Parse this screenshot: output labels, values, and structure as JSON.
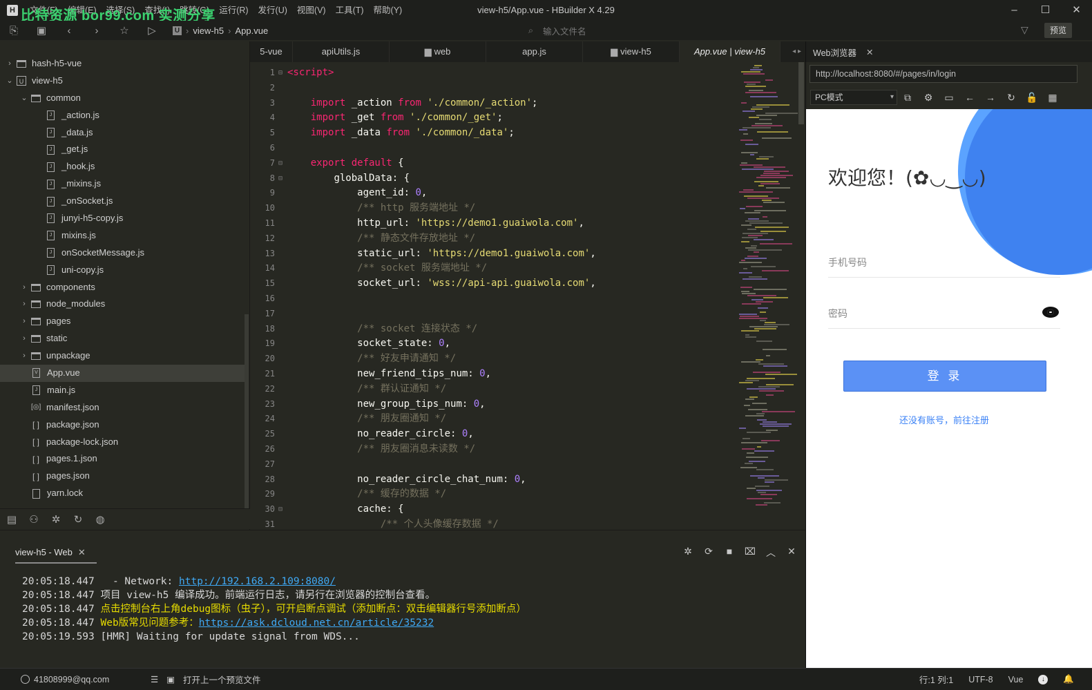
{
  "window": {
    "title": "view-h5/App.vue - HBuilder X 4.29",
    "watermark": "比特资源 bor99.com 实测分享",
    "menus": [
      "文件(F)",
      "编辑(E)",
      "选择(S)",
      "查找(I)",
      "跳转(G)",
      "运行(R)",
      "发行(U)",
      "视图(V)",
      "工具(T)",
      "帮助(Y)"
    ]
  },
  "toolbar": {
    "breadcrumb": [
      "view-h5",
      "App.vue"
    ],
    "file_search_placeholder": "输入文件名",
    "preview_label": "预览"
  },
  "sidebar": {
    "tree": [
      {
        "label": "hash-h5-vue",
        "type": "folder",
        "depth": 0,
        "expanded": false
      },
      {
        "label": "view-h5",
        "type": "project",
        "depth": 0,
        "expanded": true
      },
      {
        "label": "common",
        "type": "folder",
        "depth": 1,
        "expanded": true
      },
      {
        "label": "_action.js",
        "type": "file",
        "depth": 2
      },
      {
        "label": "_data.js",
        "type": "file",
        "depth": 2
      },
      {
        "label": "_get.js",
        "type": "file",
        "depth": 2
      },
      {
        "label": "_hook.js",
        "type": "file",
        "depth": 2
      },
      {
        "label": "_mixins.js",
        "type": "file",
        "depth": 2
      },
      {
        "label": "_onSocket.js",
        "type": "file",
        "depth": 2
      },
      {
        "label": "junyi-h5-copy.js",
        "type": "file",
        "depth": 2
      },
      {
        "label": "mixins.js",
        "type": "file",
        "depth": 2
      },
      {
        "label": "onSocketMessage.js",
        "type": "file",
        "depth": 2
      },
      {
        "label": "uni-copy.js",
        "type": "file",
        "depth": 2
      },
      {
        "label": "components",
        "type": "folder",
        "depth": 1,
        "expanded": false
      },
      {
        "label": "node_modules",
        "type": "folder",
        "depth": 1,
        "expanded": false
      },
      {
        "label": "pages",
        "type": "folder",
        "depth": 1,
        "expanded": false
      },
      {
        "label": "static",
        "type": "folder",
        "depth": 1,
        "expanded": false
      },
      {
        "label": "unpackage",
        "type": "folder",
        "depth": 1,
        "expanded": false
      },
      {
        "label": "App.vue",
        "type": "vue",
        "depth": 1,
        "selected": true
      },
      {
        "label": "main.js",
        "type": "file",
        "depth": 1
      },
      {
        "label": "manifest.json",
        "type": "manifest",
        "depth": 1
      },
      {
        "label": "package.json",
        "type": "json",
        "depth": 1
      },
      {
        "label": "package-lock.json",
        "type": "json",
        "depth": 1
      },
      {
        "label": "pages.1.json",
        "type": "json",
        "depth": 1
      },
      {
        "label": "pages.json",
        "type": "json",
        "depth": 1
      },
      {
        "label": "yarn.lock",
        "type": "plain",
        "depth": 1
      }
    ]
  },
  "editor": {
    "tabs": [
      "5-vue",
      "apiUtils.js",
      "web",
      "app.js",
      "view-h5",
      "App.vue | view-h5"
    ],
    "lines": [
      {
        "n": "1",
        "fold": true,
        "code": [
          [
            "tag",
            "<script>"
          ]
        ]
      },
      {
        "n": "2",
        "code": []
      },
      {
        "n": "3",
        "code": [
          [
            "sp",
            "    "
          ],
          [
            "kw",
            "import"
          ],
          [
            "pun",
            " _action "
          ],
          [
            "kw",
            "from"
          ],
          [
            "pun",
            " "
          ],
          [
            "str",
            "'./common/_action'"
          ],
          [
            "pun",
            ";"
          ]
        ]
      },
      {
        "n": "4",
        "code": [
          [
            "sp",
            "    "
          ],
          [
            "kw",
            "import"
          ],
          [
            "pun",
            " _get "
          ],
          [
            "kw",
            "from"
          ],
          [
            "pun",
            " "
          ],
          [
            "str",
            "'./common/_get'"
          ],
          [
            "pun",
            ";"
          ]
        ]
      },
      {
        "n": "5",
        "code": [
          [
            "sp",
            "    "
          ],
          [
            "kw",
            "import"
          ],
          [
            "pun",
            " _data "
          ],
          [
            "kw",
            "from"
          ],
          [
            "pun",
            " "
          ],
          [
            "str",
            "'./common/_data'"
          ],
          [
            "pun",
            ";"
          ]
        ]
      },
      {
        "n": "6",
        "code": []
      },
      {
        "n": "7",
        "fold": true,
        "code": [
          [
            "sp",
            "    "
          ],
          [
            "kw",
            "export default"
          ],
          [
            "pun",
            " {"
          ]
        ]
      },
      {
        "n": "8",
        "fold": true,
        "code": [
          [
            "sp",
            "        "
          ],
          [
            "pun",
            "globalData: {"
          ]
        ]
      },
      {
        "n": "9",
        "code": [
          [
            "sp",
            "            "
          ],
          [
            "pun",
            "agent_id: "
          ],
          [
            "num",
            "0"
          ],
          [
            "pun",
            ","
          ]
        ]
      },
      {
        "n": "10",
        "code": [
          [
            "sp",
            "            "
          ],
          [
            "cm",
            "/** http 服务端地址 */"
          ]
        ]
      },
      {
        "n": "11",
        "code": [
          [
            "sp",
            "            "
          ],
          [
            "pun",
            "http_url: "
          ],
          [
            "str",
            "'https://demo1.guaiwola.com'"
          ],
          [
            "pun",
            ","
          ]
        ]
      },
      {
        "n": "12",
        "code": [
          [
            "sp",
            "            "
          ],
          [
            "cm",
            "/** 静态文件存放地址 */"
          ]
        ]
      },
      {
        "n": "13",
        "code": [
          [
            "sp",
            "            "
          ],
          [
            "pun",
            "static_url: "
          ],
          [
            "str",
            "'https://demo1.guaiwola.com'"
          ],
          [
            "pun",
            ","
          ]
        ]
      },
      {
        "n": "14",
        "code": [
          [
            "sp",
            "            "
          ],
          [
            "cm",
            "/** socket 服务端地址 */"
          ]
        ]
      },
      {
        "n": "15",
        "code": [
          [
            "sp",
            "            "
          ],
          [
            "pun",
            "socket_url: "
          ],
          [
            "str",
            "'wss://api-api.guaiwola.com'"
          ],
          [
            "pun",
            ","
          ]
        ]
      },
      {
        "n": "16",
        "code": []
      },
      {
        "n": "17",
        "code": []
      },
      {
        "n": "18",
        "code": [
          [
            "sp",
            "            "
          ],
          [
            "cm",
            "/** socket 连接状态 */"
          ]
        ]
      },
      {
        "n": "19",
        "code": [
          [
            "sp",
            "            "
          ],
          [
            "pun",
            "socket_state: "
          ],
          [
            "num",
            "0"
          ],
          [
            "pun",
            ","
          ]
        ]
      },
      {
        "n": "20",
        "code": [
          [
            "sp",
            "            "
          ],
          [
            "cm",
            "/** 好友申请通知 */"
          ]
        ]
      },
      {
        "n": "21",
        "code": [
          [
            "sp",
            "            "
          ],
          [
            "pun",
            "new_friend_tips_num: "
          ],
          [
            "num",
            "0"
          ],
          [
            "pun",
            ","
          ]
        ]
      },
      {
        "n": "22",
        "code": [
          [
            "sp",
            "            "
          ],
          [
            "cm",
            "/** 群认证通知 */"
          ]
        ]
      },
      {
        "n": "23",
        "code": [
          [
            "sp",
            "            "
          ],
          [
            "pun",
            "new_group_tips_num: "
          ],
          [
            "num",
            "0"
          ],
          [
            "pun",
            ","
          ]
        ]
      },
      {
        "n": "24",
        "code": [
          [
            "sp",
            "            "
          ],
          [
            "cm",
            "/** 朋友圈通知 */"
          ]
        ]
      },
      {
        "n": "25",
        "code": [
          [
            "sp",
            "            "
          ],
          [
            "pun",
            "no_reader_circle: "
          ],
          [
            "num",
            "0"
          ],
          [
            "pun",
            ","
          ]
        ]
      },
      {
        "n": "26",
        "code": [
          [
            "sp",
            "            "
          ],
          [
            "cm",
            "/** 朋友圈消息未读数 */"
          ]
        ]
      },
      {
        "n": "27",
        "code": []
      },
      {
        "n": "28",
        "code": [
          [
            "sp",
            "            "
          ],
          [
            "pun",
            "no_reader_circle_chat_num: "
          ],
          [
            "num",
            "0"
          ],
          [
            "pun",
            ","
          ]
        ]
      },
      {
        "n": "29",
        "code": [
          [
            "sp",
            "            "
          ],
          [
            "cm",
            "/** 缓存的数据 */"
          ]
        ]
      },
      {
        "n": "30",
        "fold": true,
        "code": [
          [
            "sp",
            "            "
          ],
          [
            "pun",
            "cache: {"
          ]
        ]
      },
      {
        "n": "31",
        "code": [
          [
            "sp",
            "                "
          ],
          [
            "cm",
            "/** 个人头像缓存数据 */"
          ]
        ]
      }
    ]
  },
  "browser": {
    "tab_label": "Web浏览器",
    "url": "http://localhost:8080/#/pages/in/login",
    "mode": "PC模式",
    "page": {
      "welcome": "欢迎您！(✿◡‿◡)",
      "phone_placeholder": "手机号码",
      "password_placeholder": "密码",
      "login_button": "登 录",
      "register_link": "还没有账号，前往注册"
    }
  },
  "console": {
    "tab_label": "view-h5 - Web",
    "logs": [
      {
        "time": "20:05:18.447",
        "parts": [
          [
            "t",
            "  - Network: "
          ],
          [
            "a",
            "http://192.168.2.109:8080/"
          ]
        ]
      },
      {
        "time": "20:05:18.447",
        "parts": [
          [
            "t",
            "项目 view-h5 编译成功。前端运行日志，请另行在浏览器的控制台查看。"
          ]
        ]
      },
      {
        "time": "20:05:18.447",
        "parts": [
          [
            "y",
            "点击控制台右上角debug图标（虫子），可开启断点调试（添加断点：双击编辑器行号添加断点）"
          ]
        ]
      },
      {
        "time": "20:05:18.447",
        "parts": [
          [
            "y",
            "Web版常见问题参考："
          ],
          [
            "a",
            "https://ask.dcloud.net.cn/article/35232"
          ]
        ]
      },
      {
        "time": "20:05:19.593",
        "parts": [
          [
            "t",
            "[HMR] Waiting for update signal from WDS..."
          ]
        ]
      }
    ]
  },
  "status": {
    "user": "41808999@qq.com",
    "open_prev": "打开上一个预览文件",
    "position": "行:1   列:1",
    "encoding": "UTF-8",
    "language": "Vue"
  }
}
